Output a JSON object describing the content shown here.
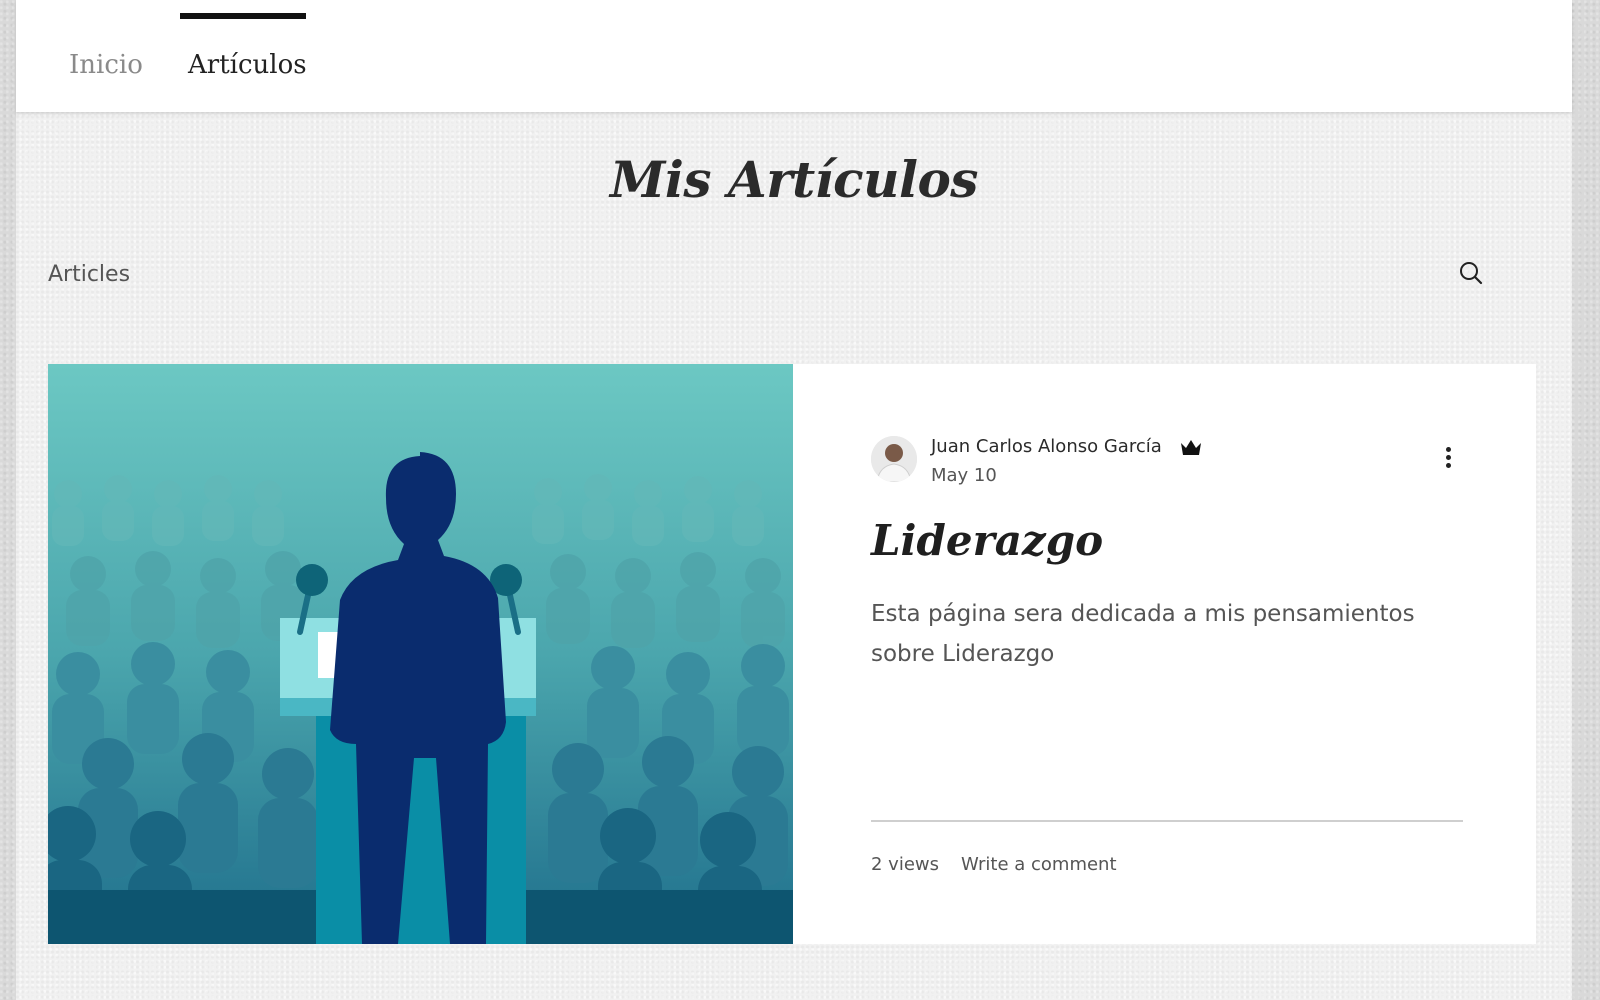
{
  "nav": {
    "items": [
      {
        "label": "Inicio",
        "active": false
      },
      {
        "label": "Artículos",
        "active": true
      }
    ]
  },
  "page": {
    "title": "Mis Artículos",
    "category": "Articles"
  },
  "post": {
    "author": "Juan Carlos Alonso García",
    "date": "May 10",
    "title": "Liderazgo",
    "excerpt": "Esta página sera dedicada a mis pensamientos sobre Liderazgo",
    "views": "2 views",
    "comment_label": "Write a comment",
    "image_icon": "speaker-at-podium-illustration"
  },
  "colors": {
    "accent": "#111111",
    "illustration_sky": "#6cc6c2",
    "illustration_speaker": "#0a2c6e"
  }
}
